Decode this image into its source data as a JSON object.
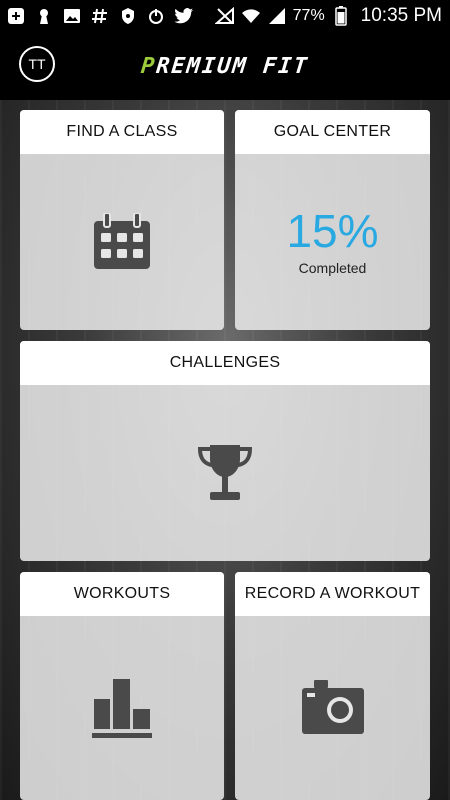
{
  "status_bar": {
    "battery_text": "77%",
    "time": "10:35 PM",
    "icons": [
      "add-icon",
      "keyhole-icon",
      "image-icon",
      "hashtag-icon",
      "shield-icon",
      "power-icon",
      "twitter-icon",
      "no-signal-icon",
      "wifi-icon",
      "signal-icon",
      "battery-icon"
    ]
  },
  "header": {
    "avatar_initials": "TT",
    "logo_first": "P",
    "logo_rest": "REMIUM FIT"
  },
  "tiles": {
    "find_class": {
      "title": "FIND A CLASS",
      "icon": "calendar-icon"
    },
    "goal_center": {
      "title": "GOAL CENTER",
      "percent": "15%",
      "progress": 0.15,
      "label": "Completed"
    },
    "challenges": {
      "title": "CHALLENGES",
      "icon": "trophy-icon"
    },
    "workouts": {
      "title": "WORKOUTS",
      "icon": "bar-chart-icon"
    },
    "record_workout": {
      "title": "RECORD A WORKOUT",
      "icon": "camera-icon"
    }
  },
  "colors": {
    "accent": "#29a9e1",
    "brand_green": "#9ccb3b",
    "icon_gray": "#4a4a4a"
  }
}
